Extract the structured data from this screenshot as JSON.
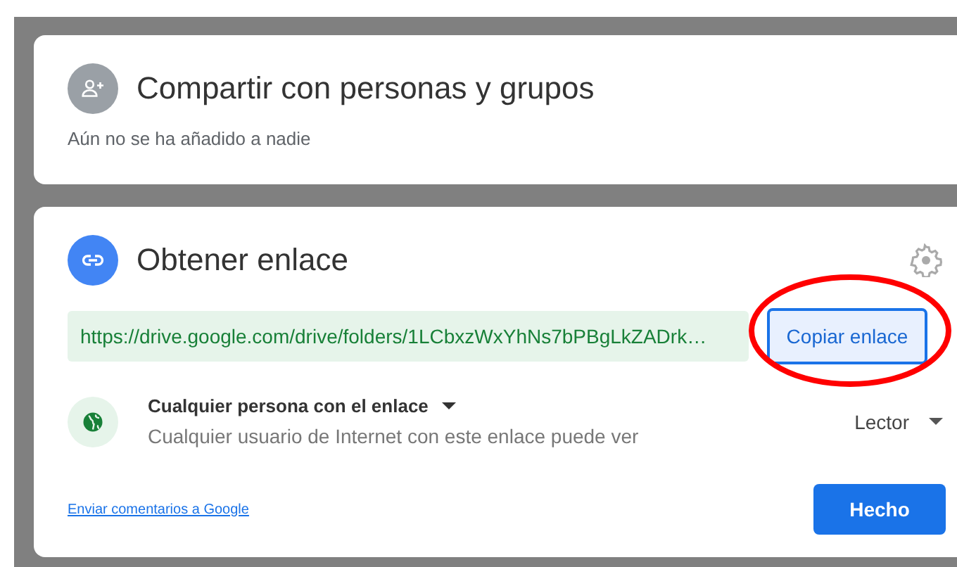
{
  "share_card": {
    "title": "Compartir con personas y grupos",
    "subtitle": "Aún no se ha añadido a nadie"
  },
  "link_card": {
    "title": "Obtener enlace",
    "url": "https://drive.google.com/drive/folders/1LCbxzWxYhNs7bPBgLkZADrk…",
    "copy_button": "Copiar enlace",
    "access": {
      "label": "Cualquier persona con el enlace",
      "description": "Cualquier usuario de Internet con este enlace puede ver",
      "role": "Lector"
    },
    "feedback_link": "Enviar comentarios a Google",
    "done_button": "Hecho"
  },
  "annotation": {
    "kind": "ellipse",
    "color": "#ff0000"
  }
}
